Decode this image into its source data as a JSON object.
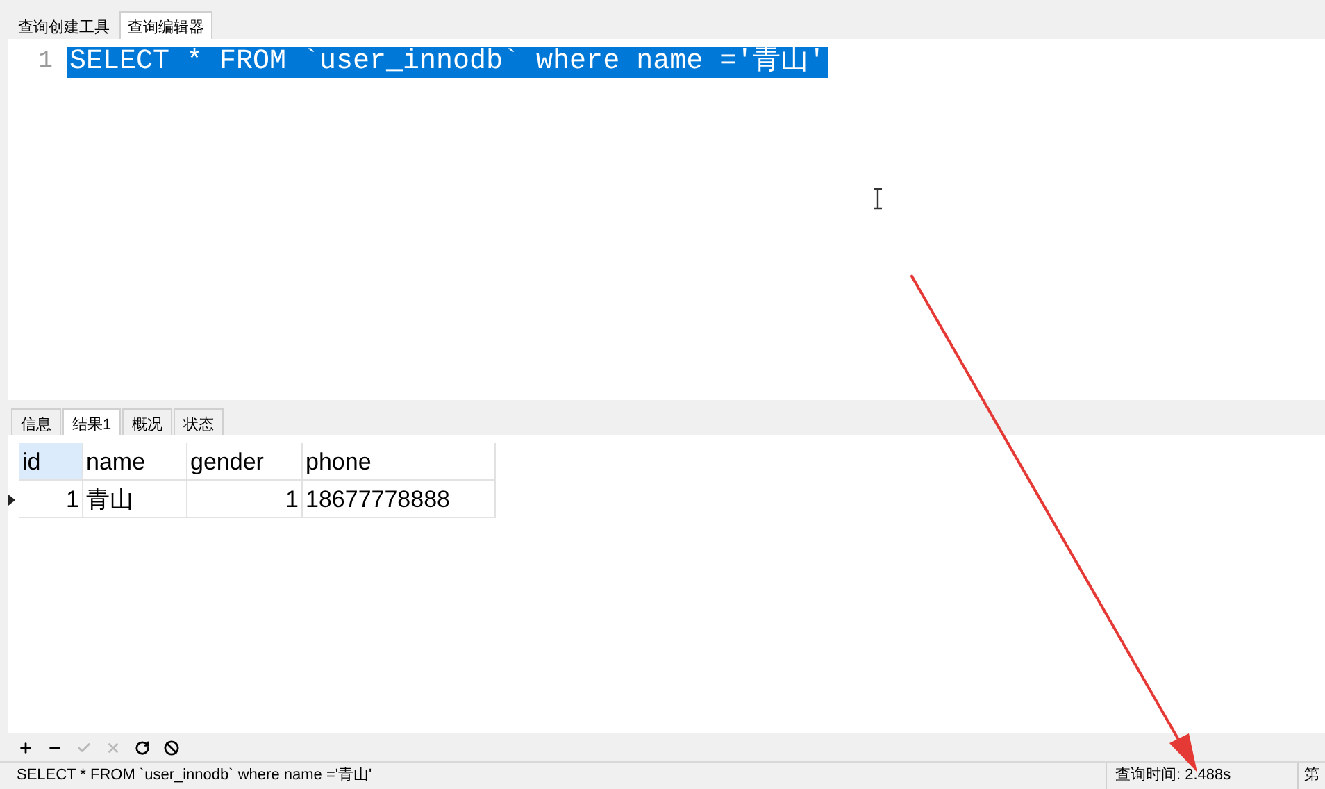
{
  "editor_tabs": [
    {
      "label": "查询创建工具",
      "selected": false
    },
    {
      "label": "查询编辑器",
      "selected": true
    }
  ],
  "editor": {
    "lines": [
      {
        "number": "1",
        "text": "SELECT * FROM `user_innodb` where name ='青山'",
        "selected": true
      }
    ]
  },
  "result_tabs": [
    {
      "label": "信息",
      "selected": false
    },
    {
      "label": "结果1",
      "selected": true
    },
    {
      "label": "概况",
      "selected": false
    },
    {
      "label": "状态",
      "selected": false
    }
  ],
  "grid": {
    "columns": [
      {
        "label": "id",
        "kind": "number",
        "selected": true
      },
      {
        "label": "name",
        "kind": "text",
        "selected": false
      },
      {
        "label": "gender",
        "kind": "number",
        "selected": false
      },
      {
        "label": "phone",
        "kind": "text",
        "selected": false
      }
    ],
    "rows": [
      {
        "current": true,
        "cells": [
          "1",
          "青山",
          "1",
          "18677778888"
        ]
      }
    ]
  },
  "grid_toolbar": [
    {
      "kind": "add",
      "disabled": false
    },
    {
      "kind": "remove",
      "disabled": false
    },
    {
      "kind": "apply",
      "disabled": true
    },
    {
      "kind": "discard",
      "disabled": true
    },
    {
      "kind": "refresh",
      "disabled": false
    },
    {
      "kind": "stop",
      "disabled": false
    }
  ],
  "status_bar": {
    "sql": "SELECT * FROM `user_innodb` where name ='青山'",
    "query_time": "查询时间: 2.488s",
    "page": "第"
  }
}
